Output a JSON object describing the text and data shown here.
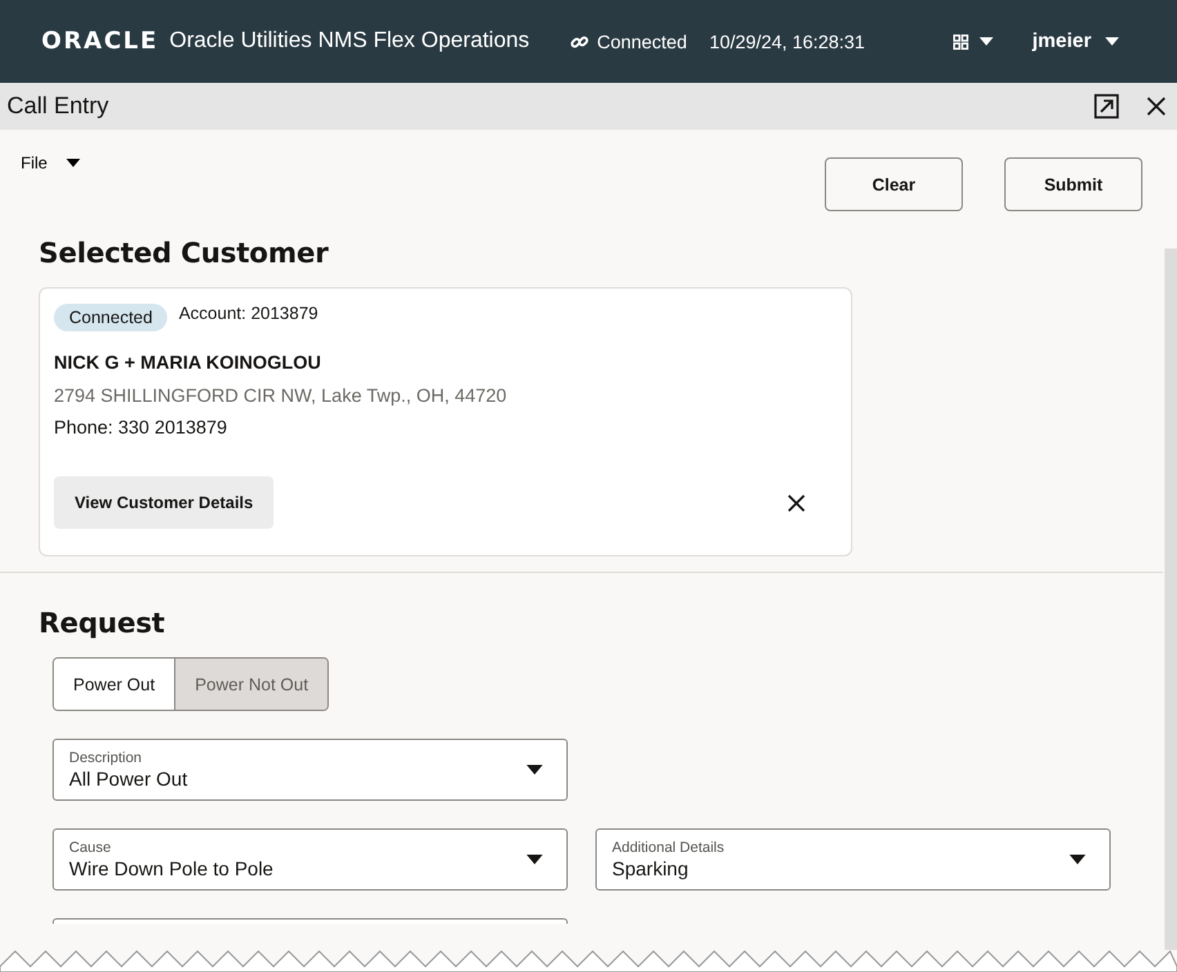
{
  "header": {
    "logo": "ORACLE",
    "product": "Oracle Utilities NMS Flex Operations",
    "connection": "Connected",
    "datetime": "10/29/24, 16:28:31",
    "user": "jmeier"
  },
  "panel": {
    "title": "Call Entry"
  },
  "menu": {
    "label": "File"
  },
  "actions": [
    "Clear",
    "Submit"
  ],
  "selected_customer": {
    "heading": "Selected Customer",
    "status": "Connected",
    "account": "Account: 2013879",
    "name": "NICK G + MARIA KOINOGLOU",
    "address": "2794 SHILLINGFORD CIR NW, Lake Twp., OH, 44720",
    "phone": "Phone: 330 2013879",
    "details_button": "View Customer Details"
  },
  "request": {
    "heading": "Request",
    "toggle": [
      {
        "label": "Power Out",
        "selected": true
      },
      {
        "label": "Power Not Out",
        "selected": false
      }
    ],
    "field_rows": [
      [
        {
          "label": "Description",
          "value": "All Power Out"
        }
      ],
      [
        {
          "label": "Cause",
          "value": "Wire Down Pole to Pole"
        },
        {
          "label": "Additional Details",
          "value": "Sparking"
        }
      ]
    ]
  }
}
